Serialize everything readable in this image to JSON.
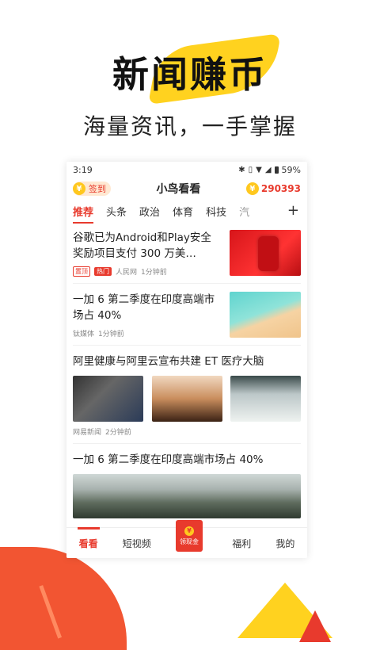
{
  "hero": {
    "title": "新闻赚币",
    "subtitle": "海量资讯，一手掌握"
  },
  "status": {
    "time": "3:19",
    "battery": "59%"
  },
  "header": {
    "signin_label": "签到",
    "coin_symbol": "¥",
    "app_title": "小鸟看看",
    "coins": "290393"
  },
  "tabs": [
    "推荐",
    "头条",
    "政治",
    "体育",
    "科技",
    "汽"
  ],
  "feed": {
    "item1": {
      "title": "谷歌已为Android和Play安全奖励项目支付 300 万美…",
      "tag_top": "置顶",
      "tag_hot": "热门",
      "source": "人民网",
      "time": "1分钟前"
    },
    "item2": {
      "title": "一加 6 第二季度在印度高端市场占 40%",
      "source": "钛媒体",
      "time": "1分钟前"
    },
    "item3": {
      "title": "阿里健康与阿里云宣布共建 ET 医疗大脑",
      "source": "网易新闻",
      "time": "2分钟前"
    },
    "item4": {
      "title": "一加 6 第二季度在印度高端市场占 40%"
    }
  },
  "bottom_nav": {
    "watch": "看看",
    "short_video": "短视频",
    "cash_label": "领现金",
    "welfare": "福利",
    "mine": "我的"
  },
  "colors": {
    "accent": "#e83a2d",
    "gold": "#ffc81f"
  }
}
